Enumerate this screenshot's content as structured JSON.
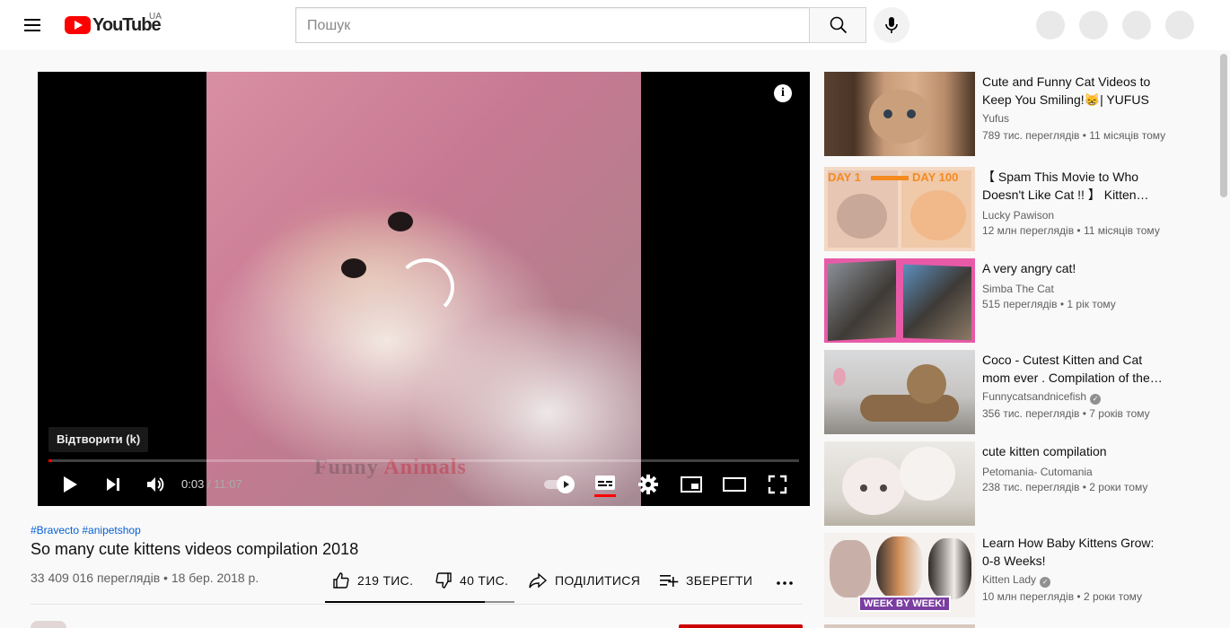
{
  "header": {
    "logo_text": "YouTube",
    "country_code": "UA",
    "search_placeholder": "Пошук",
    "search_value": ""
  },
  "player": {
    "tooltip": "Відтворити (k)",
    "current_time": "0:03",
    "time_separator": " / ",
    "duration": "11:07",
    "progress_fraction": 0.005,
    "watermark_part1": "Funny ",
    "watermark_part2": "Animals",
    "info_label": "i"
  },
  "video": {
    "hashtags": [
      "#Bravecto",
      "#anipetshop"
    ],
    "title": "So many cute kittens videos compilation 2018",
    "meta": "33 409 016 переглядів • 18 бер. 2018 р.",
    "likes": "219 ТИС.",
    "dislikes": "40 ТИС.",
    "share_label": "ПОДІЛИТИСЯ",
    "save_label": "ЗБЕРЕГТИ",
    "like_ratio": 0.845
  },
  "recommendations": [
    {
      "title": "Cute and Funny Cat Videos to Keep You Smiling!😸| YUFUS",
      "channel": "Yufus",
      "verified": false,
      "stats": "789 тис. переглядів • 11 місяців тому"
    },
    {
      "title": "【 Spam This Movie to Who Doesn't Like Cat !! 】 Kitten…",
      "channel": "Lucky Pawison",
      "verified": false,
      "stats": "12 млн переглядів • 11 місяців тому"
    },
    {
      "title": "A very angry cat!",
      "channel": "Simba The Cat",
      "verified": false,
      "stats": "515 переглядів • 1 рік тому"
    },
    {
      "title": "Coco - Cutest Kitten and Cat mom ever . Compilation of the…",
      "channel": "Funnycatsandnicefish",
      "verified": true,
      "stats": "356 тис. переглядів • 7 років тому"
    },
    {
      "title": "cute kitten compilation",
      "channel": "Petomania- Cutomania",
      "verified": false,
      "stats": "238 тис. переглядів • 2 роки тому"
    },
    {
      "title": "Learn How Baby Kittens Grow: 0-8 Weeks!",
      "channel": "Kitten Lady",
      "verified": true,
      "stats": "10 млн переглядів • 2 роки тому"
    }
  ],
  "thumb_text": {
    "day1": "DAY 1",
    "day100": "DAY 100",
    "week_by_week": "WEEK BY WEEK!"
  },
  "colors": {
    "brand_red": "#ff0000",
    "link_blue": "#065fd4",
    "meta_gray": "#606060"
  }
}
